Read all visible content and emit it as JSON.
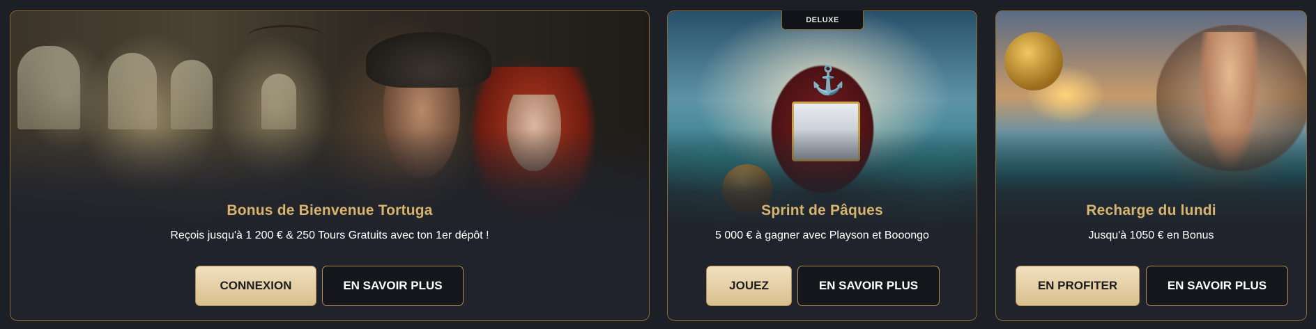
{
  "cards": [
    {
      "title": "Bonus de Bienvenue Tortuga",
      "description": "Reçois jusqu'à 1 200 € & 250 Tours Gratuits avec ton 1er dépôt !",
      "primary_button": "CONNEXION",
      "secondary_button": "EN SAVOIR PLUS"
    },
    {
      "badge": "DELUXE",
      "title": "Sprint de Pâques",
      "description": "5 000 € à gagner avec Playson et Booongo",
      "primary_button": "JOUEZ",
      "secondary_button": "EN SAVOIR PLUS"
    },
    {
      "title": "Recharge du lundi",
      "description": "Jusqu'à 1050 € en Bonus",
      "primary_button": "EN PROFITER",
      "secondary_button": "EN SAVOIR PLUS"
    }
  ],
  "colors": {
    "background": "#1c1f26",
    "card_border": "#8a6a30",
    "title_gold": "#d9b46e",
    "primary_button": "#e6cfa3",
    "secondary_button": "#15171c"
  }
}
